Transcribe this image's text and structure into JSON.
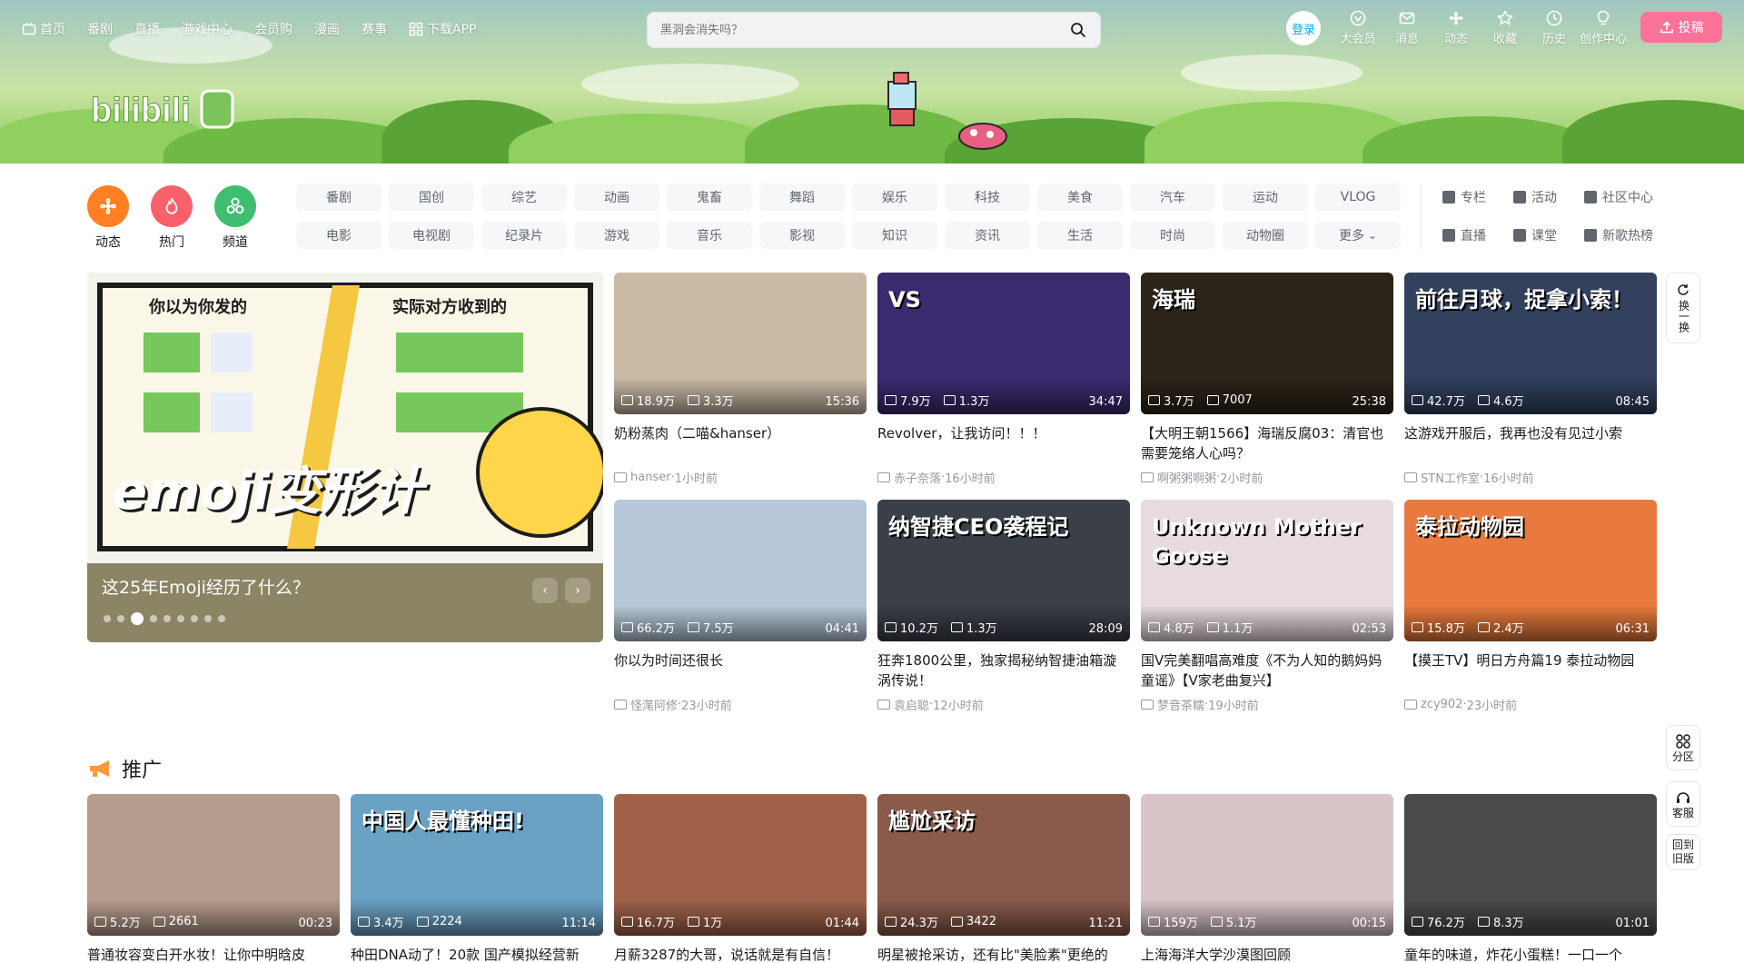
{
  "topnav": {
    "left": [
      {
        "label": "首页",
        "icon": "tv-icon"
      },
      {
        "label": "番剧"
      },
      {
        "label": "直播"
      },
      {
        "label": "游戏中心"
      },
      {
        "label": "会员购"
      },
      {
        "label": "漫画"
      },
      {
        "label": "赛事"
      },
      {
        "label": "下载APP",
        "icon": "download-icon"
      }
    ],
    "search_placeholder": "黑洞会消失吗？",
    "login_label": "登录",
    "right": [
      {
        "label": "大会员",
        "icon": "vip-icon"
      },
      {
        "label": "消息",
        "icon": "mail-icon"
      },
      {
        "label": "动态",
        "icon": "wind-icon"
      },
      {
        "label": "收藏",
        "icon": "star-icon"
      },
      {
        "label": "历史",
        "icon": "clock-icon"
      },
      {
        "label": "创作中心",
        "icon": "bulb-icon"
      }
    ],
    "upload_label": "投稿"
  },
  "channels": [
    {
      "label": "动态",
      "color": "#ff7f24"
    },
    {
      "label": "热门",
      "color": "#f9616a"
    },
    {
      "label": "频道",
      "color": "#3fbe6f"
    }
  ],
  "tags": [
    "番剧",
    "国创",
    "综艺",
    "动画",
    "鬼畜",
    "舞蹈",
    "娱乐",
    "科技",
    "美食",
    "汽车",
    "运动",
    "VLOG",
    "电影",
    "电视剧",
    "纪录片",
    "游戏",
    "音乐",
    "影视",
    "知识",
    "资讯",
    "生活",
    "时尚",
    "动物圈",
    "更多"
  ],
  "side_links": [
    "专栏",
    "活动",
    "社区中心",
    "直播",
    "课堂",
    "新歌热榜"
  ],
  "carousel": {
    "title": "这25年Emoji经历了什么？",
    "art_left_label": "你以为你发的",
    "art_right_label": "实际对方收到的",
    "art_big_text": "emoji变形计",
    "dots": 9,
    "active_dot": 2
  },
  "videos": [
    {
      "views": "18.9万",
      "likes": "3.3万",
      "duration": "15:36",
      "title": "奶粉蒸肉（二喵&hanser）",
      "author": "hanser",
      "time": "1小时前",
      "bg": "#c9b9a5"
    },
    {
      "views": "7.9万",
      "likes": "1.3万",
      "duration": "34:47",
      "title": "Revolver，让我访问！！！",
      "author": "赤子奈落",
      "time": "16小时前",
      "bg": "#3b2a6e",
      "overlay": "VS"
    },
    {
      "views": "3.7万",
      "likes": "7007",
      "duration": "25:38",
      "title": "【大明王朝1566】海瑞反腐03：清官也需要笼络人心吗？",
      "author": "啊粥粥啊粥",
      "time": "2小时前",
      "bg": "#2c2418",
      "overlay": "海瑞"
    },
    {
      "views": "42.7万",
      "likes": "4.6万",
      "duration": "08:45",
      "title": "这游戏开服后，我再也没有见过小索",
      "author": "STN工作室",
      "time": "16小时前",
      "bg": "#31415e",
      "overlay": "前往月球，捉拿小索！"
    },
    {
      "views": "66.2万",
      "likes": "7.5万",
      "duration": "04:41",
      "title": "你以为时间还很长",
      "author": "怪滗阿修",
      "time": "23小时前",
      "bg": "#b7c9d8"
    },
    {
      "views": "10.2万",
      "likes": "1.3万",
      "duration": "28:09",
      "title": "狂奔1800公里，独家揭秘纳智捷油箱漩涡传说！",
      "author": "袁启聪",
      "time": "12小时前",
      "bg": "#3a3f48",
      "overlay": "纳智捷CEO袭程记"
    },
    {
      "views": "4.8万",
      "likes": "1.1万",
      "duration": "02:53",
      "title": "国V完美翻唱高难度《不为人知的鹅妈妈童谣》【V家老曲复兴】",
      "author": "梦音茶糯",
      "time": "19小时前",
      "bg": "#e8dbe0",
      "overlay": "Unknown Mother Goose"
    },
    {
      "views": "15.8万",
      "likes": "2.4万",
      "duration": "06:31",
      "title": "【摸王TV】明日方舟篇19 泰拉动物园",
      "author": "zcy902",
      "time": "23小时前",
      "bg": "#e77a3c",
      "overlay": "泰拉动物园"
    }
  ],
  "promo": {
    "heading": "推广",
    "items": [
      {
        "views": "5.2万",
        "likes": "2661",
        "duration": "00:23",
        "title": "普通妆容变白开水妆！让你中明晗皮",
        "bg": "#b69c8c"
      },
      {
        "views": "3.4万",
        "likes": "2224",
        "duration": "11:14",
        "title": "种田DNA动了！20款 国产模拟经营新",
        "bg": "#6aa2c4",
        "overlay": "中国人最懂种田!"
      },
      {
        "views": "16.7万",
        "likes": "1万",
        "duration": "01:44",
        "title": "月薪3287的大哥，说话就是有自信！",
        "bg": "#a0634a"
      },
      {
        "views": "24.3万",
        "likes": "3422",
        "duration": "11:21",
        "title": "明星被抢采访，还有比\"美脸素\"更绝的",
        "bg": "#8a5a4a",
        "overlay": "尴尬采访"
      },
      {
        "views": "159万",
        "likes": "5.1万",
        "duration": "00:15",
        "title": "上海海洋大学沙漠图回顾",
        "bg": "#d9c4c8"
      },
      {
        "views": "76.2万",
        "likes": "8.3万",
        "duration": "01:01",
        "title": "童年的味道，炸花小蛋糕！一口一个",
        "bg": "#4a4a4a"
      }
    ]
  },
  "float_buttons": [
    {
      "label": "换一换"
    },
    {
      "label": "分区"
    },
    {
      "label": "客服"
    },
    {
      "label": "回到旧版"
    }
  ],
  "colors": {
    "accent": "#00aeec",
    "pink": "#fb7299"
  }
}
